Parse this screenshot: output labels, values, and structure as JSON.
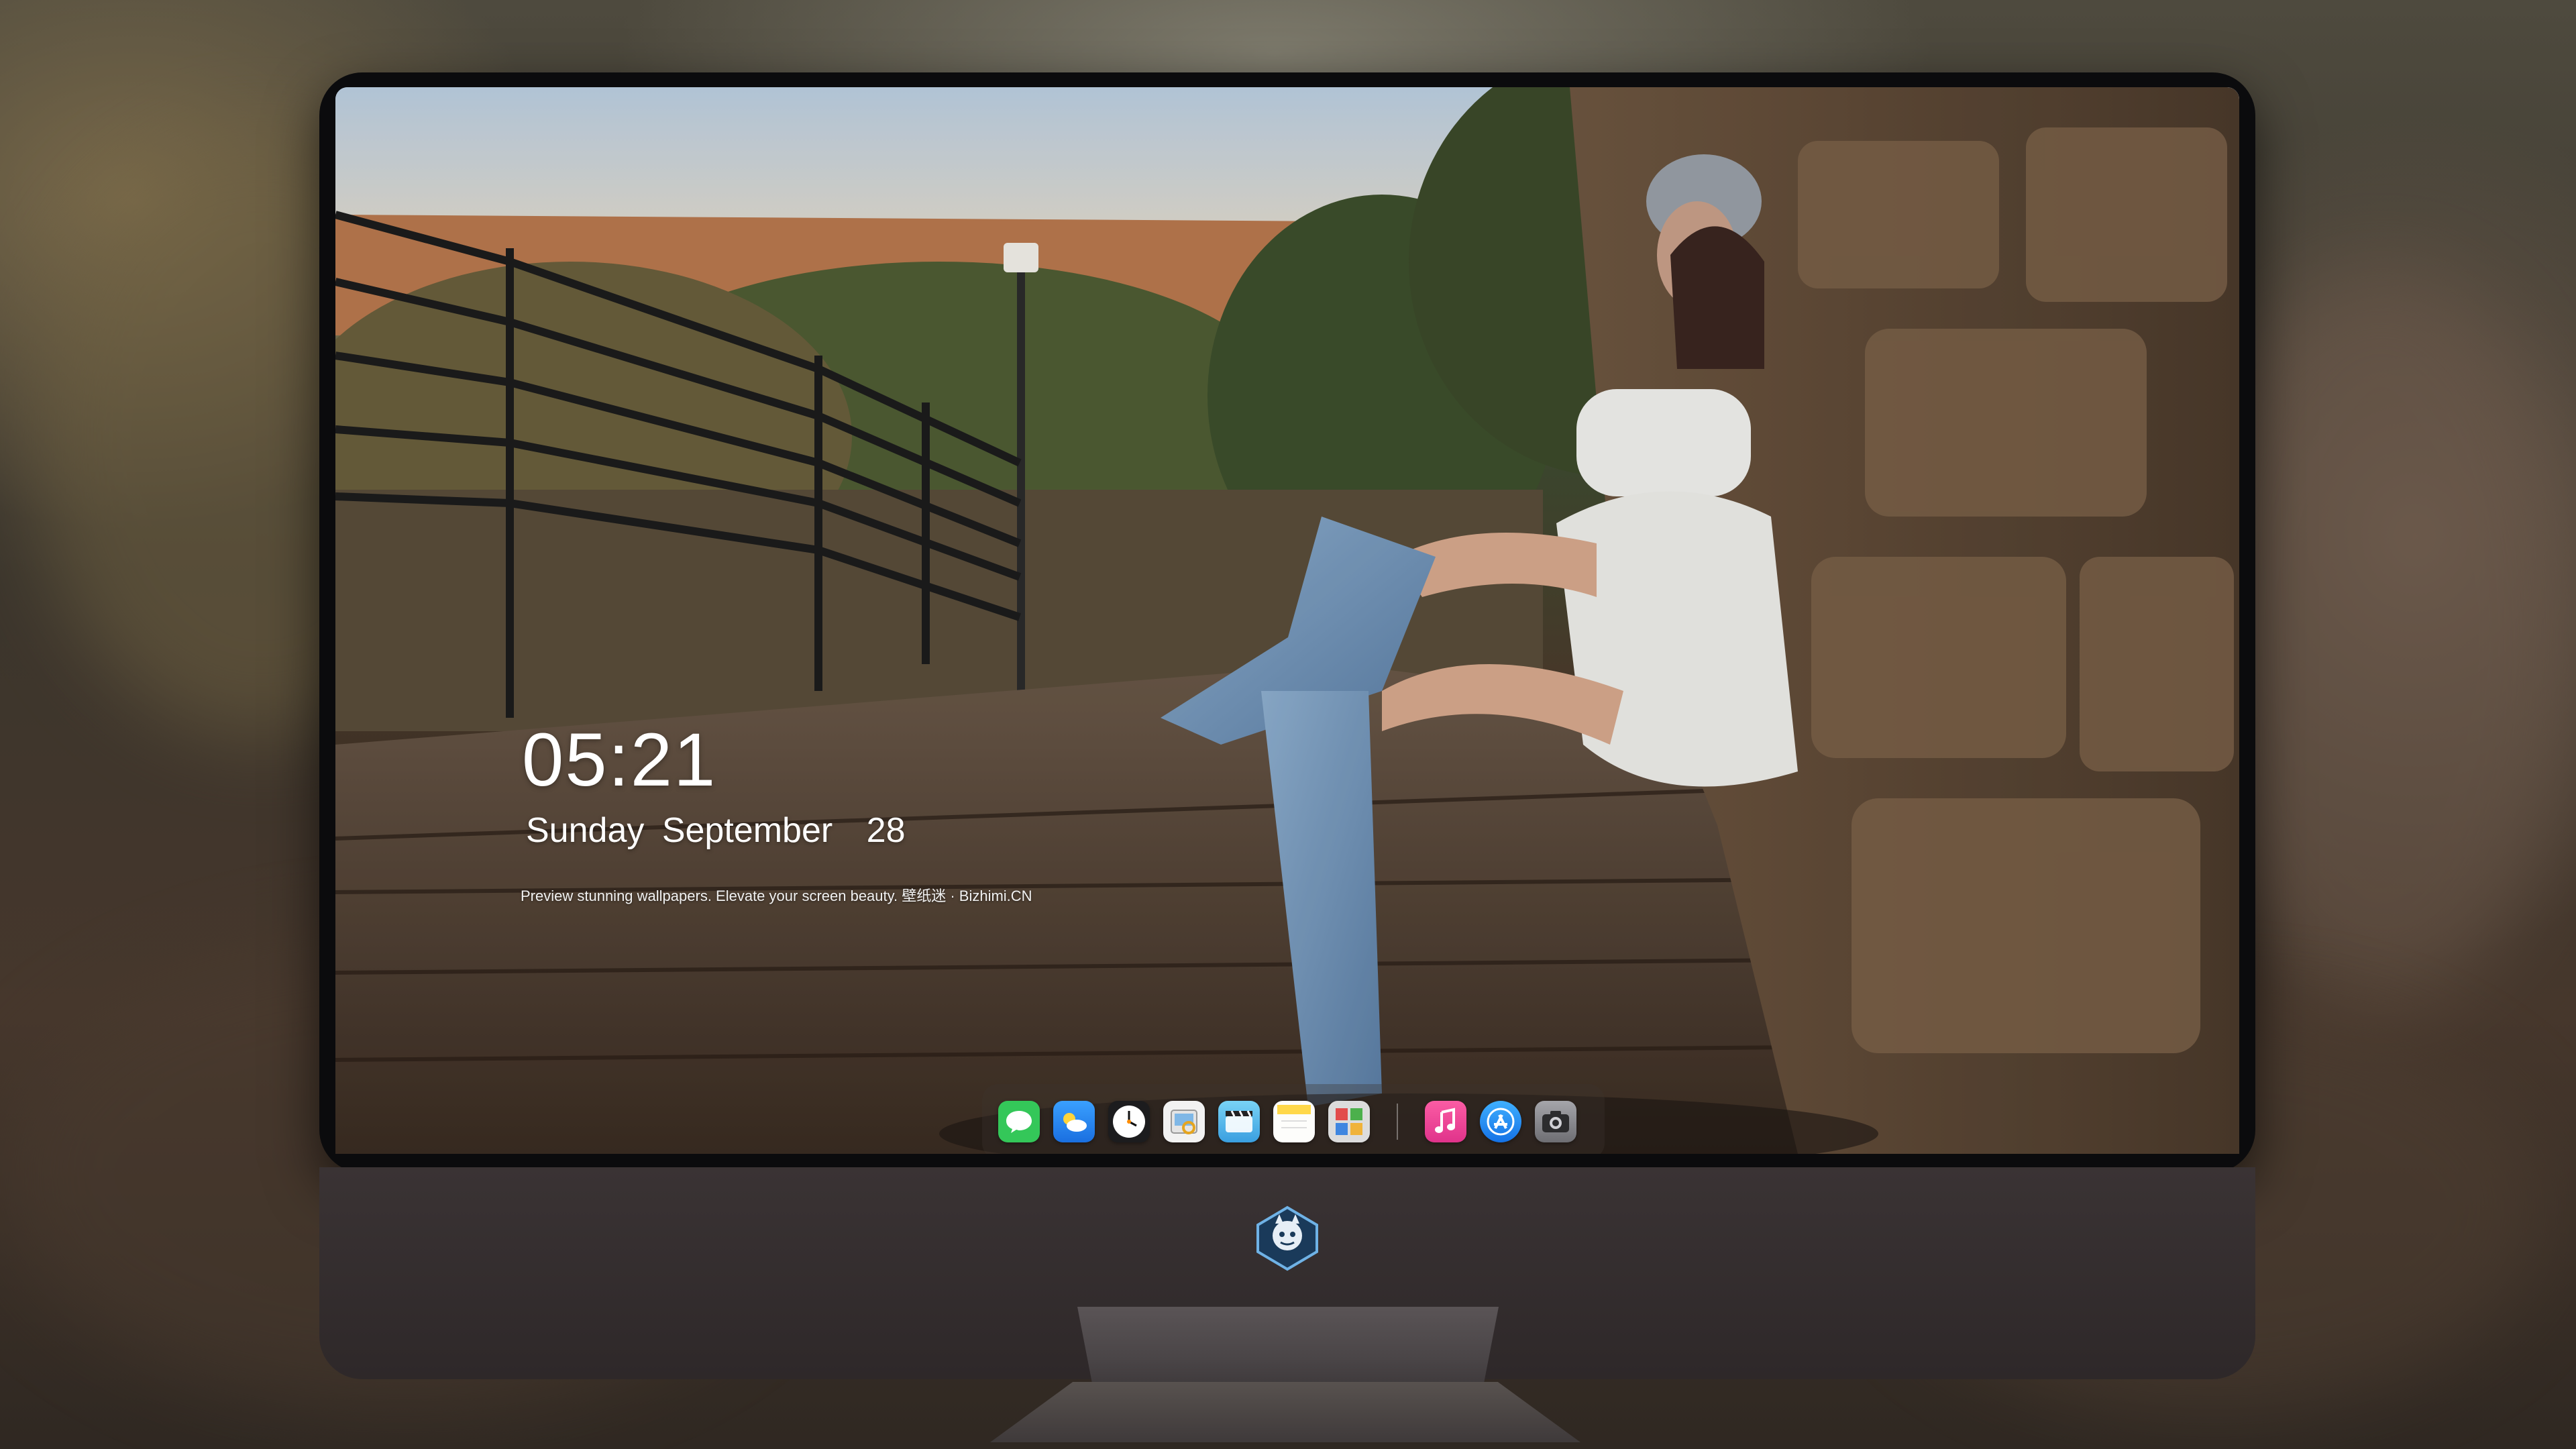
{
  "lock_screen": {
    "time": "05:21",
    "day": "Sunday",
    "month": "September",
    "date": "28",
    "tagline": "Preview stunning wallpapers. Elevate your screen beauty. 壁纸迷 · Bizhimi.CN"
  },
  "dock": {
    "apps": [
      {
        "icon": "messages-icon",
        "color": "#34c759"
      },
      {
        "icon": "weather-icon",
        "color": "#2f8cff"
      },
      {
        "icon": "clock-icon",
        "color": "#ffffff"
      },
      {
        "icon": "preview-icon",
        "color": "#f5f5f5"
      },
      {
        "icon": "clips-icon",
        "color": "#5ac8fa"
      },
      {
        "icon": "notes-icon",
        "color": "#ffd84a"
      },
      {
        "icon": "photo-booth-icon",
        "color": "#e7e7e7"
      },
      {
        "icon": "music-icon",
        "color": "#fc3c8c"
      },
      {
        "icon": "app-store-icon",
        "color": "#1c8ef9"
      },
      {
        "icon": "camera-icon",
        "color": "#8e8e93"
      }
    ]
  },
  "colors": {
    "monitor_frame": "#0b0b0d",
    "monitor_chin": "#332d2e",
    "stand": "#4a4547",
    "text": "#ffffff"
  }
}
